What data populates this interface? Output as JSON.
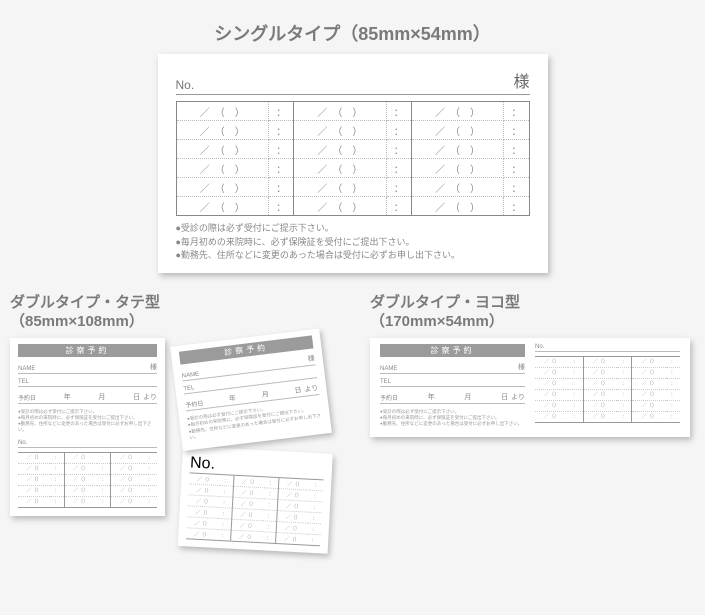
{
  "single": {
    "title": "シングルタイプ（85mm×54mm）",
    "no_label": "No.",
    "sama": "様",
    "cell_date": "／　（　）",
    "cell_time": "：",
    "notes": [
      "●受診の際は必ず受付にご提示下さい。",
      "●毎月初めの来院時に、必ず保険証を受付にご提出下さい。",
      "●勤務先、住所などに変更のあった場合は受付に必ずお申し出下さい。"
    ]
  },
  "tate": {
    "title_line1": "ダブルタイプ・タテ型",
    "title_line2": "（85mm×108mm）",
    "bar": "診察予約",
    "name_label": "NAME",
    "sama": "様",
    "tel_label": "TEL",
    "yoyaku_label": "予約日",
    "yoyaku_tail_y": "年",
    "yoyaku_tail_m": "月",
    "yoyaku_tail_d": "日",
    "yoyaku_tail_e": "より",
    "notes": [
      "●受診の際は必ず受付にご提示下さい。",
      "●毎月初めの来院時に、必ず保険証を受付にご提出下さい。",
      "●勤務先、住所などに変更のあった場合は受付に必ずお申し出下さい。"
    ],
    "no_label": "No.",
    "cell_date": "／（）",
    "cell_time": "："
  },
  "yoko": {
    "title_line1": "ダブルタイプ・ヨコ型",
    "title_line2": "（170mm×54mm）",
    "bar": "診察予約",
    "name_label": "NAME",
    "sama": "様",
    "tel_label": "TEL",
    "yoyaku_label": "予約日",
    "yoyaku_tail_y": "年",
    "yoyaku_tail_m": "月",
    "yoyaku_tail_d": "日",
    "yoyaku_tail_e": "より",
    "notes": [
      "●受診の際は必ず受付にご提示下さい。",
      "●毎月初めの来院時に、必ず保険証を受付にご提出下さい。",
      "●勤務先、住所などに変更のあった場合は受付に必ずお申し出下さい。"
    ],
    "no_label": "No.",
    "cell_date": "／（）",
    "cell_time": "："
  }
}
